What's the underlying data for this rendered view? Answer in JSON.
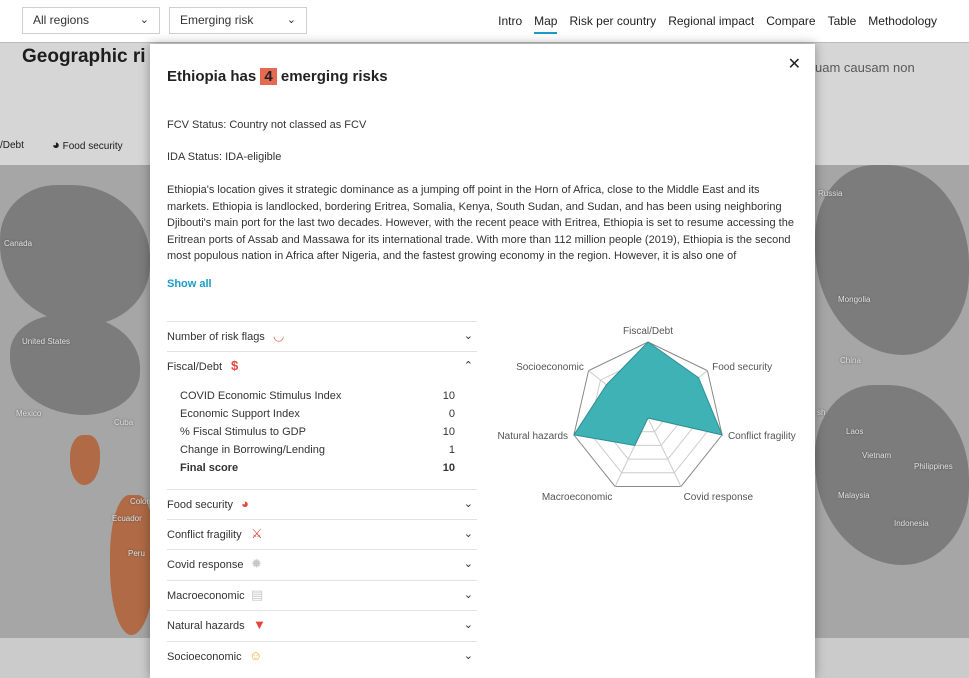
{
  "topbar": {
    "region_select": "All regions",
    "risk_select": "Emerging risk",
    "nav": [
      "Intro",
      "Map",
      "Risk per country",
      "Regional impact",
      "Compare",
      "Table",
      "Methodology"
    ],
    "active_nav": "Map"
  },
  "background": {
    "title": "Geographic ri",
    "text": "uam causam non",
    "legend": [
      "/Debt",
      "Food security"
    ],
    "map_labels": [
      "Canada",
      "United States",
      "Mexico",
      "Cuba",
      "Colom",
      "Ecuador",
      "Peru",
      "Russia",
      "Mongolia",
      "China",
      "Laos",
      "Vietnam",
      "Philippines",
      "Malaysia",
      "Indonesia",
      "sh"
    ]
  },
  "modal": {
    "title_prefix": "Ethiopia has",
    "risk_count": "4",
    "title_suffix": "emerging risks",
    "fcv_status": "FCV Status: Country not classed as FCV",
    "ida_status": "IDA Status: IDA-eligible",
    "description": "Ethiopia's location gives it strategic dominance as a jumping off point in the Horn of Africa, close to the Middle East and its markets. Ethiopia is landlocked, bordering Eritrea, Somalia, Kenya, South Sudan, and Sudan, and has been using neighboring Djibouti's main port for the last two decades. However, with the recent peace with Eritrea, Ethiopia is set to resume accessing the Eritrean ports of Assab and Massawa for its international trade. With more than 112 million people (2019), Ethiopia is the second most populous nation in Africa after Nigeria, and the fastest growing economy in the region. However, it is also one of",
    "show_all": "Show all",
    "accordion": [
      {
        "label": "Number of risk flags",
        "icon": "risk-meter-icon"
      },
      {
        "label": "Fiscal/Debt",
        "icon": "money-icon"
      },
      {
        "label": "Food security",
        "icon": "bowl-icon"
      },
      {
        "label": "Conflict fragility",
        "icon": "conflict-icon"
      },
      {
        "label": "Covid response",
        "icon": "virus-icon"
      },
      {
        "label": "Macroeconomic",
        "icon": "bar-chart-icon"
      },
      {
        "label": "Natural hazards",
        "icon": "tornado-icon"
      },
      {
        "label": "Socioeconomic",
        "icon": "people-icon"
      }
    ],
    "fiscal_rows": [
      {
        "label": "COVID Economic Stimulus Index",
        "value": "10"
      },
      {
        "label": "Economic Support Index",
        "value": "0"
      },
      {
        "label": "% Fiscal Stimulus to GDP",
        "value": "10"
      },
      {
        "label": "Change in Borrowing/Lending",
        "value": "1"
      },
      {
        "label": "Final score",
        "value": "10"
      }
    ]
  },
  "chart_data": {
    "type": "radar",
    "categories": [
      "Fiscal/Debt",
      "Food security",
      "Conflict fragility",
      "Covid response",
      "Macroeconomic",
      "Natural hazards",
      "Socioeconomic"
    ],
    "values": [
      10,
      8.5,
      10,
      0,
      4,
      10,
      7
    ],
    "range": [
      0,
      10
    ],
    "fill_color": "#3fb2b6"
  }
}
